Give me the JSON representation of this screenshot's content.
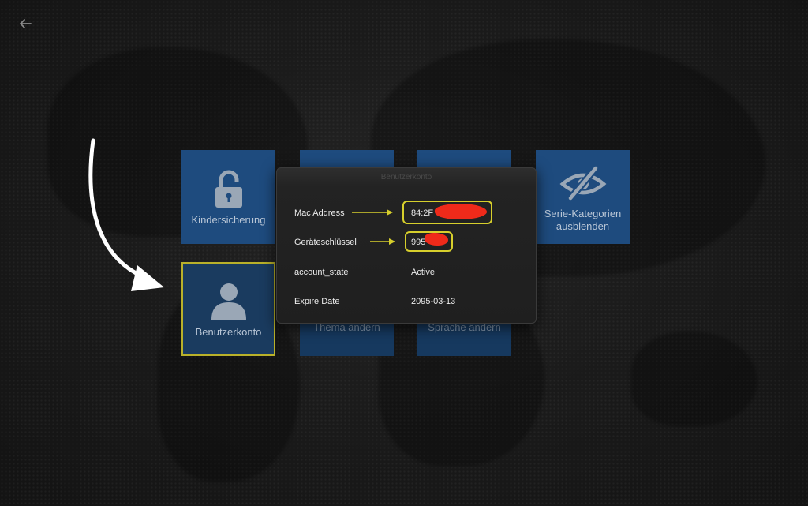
{
  "nav": {
    "back_icon": "arrow-left-icon"
  },
  "tiles": [
    {
      "label": "Kindersicherung",
      "icon": "lock-open-icon"
    },
    {
      "label": "",
      "icon": "pencil-icon"
    },
    {
      "label": "",
      "icon": "pencil-icon"
    },
    {
      "label": "Serie-Kategorien ausblenden",
      "icon": "eye-off-icon"
    },
    {
      "label": "Benutzerkonto",
      "icon": "user-icon"
    },
    {
      "label": "Thema ändern",
      "icon": "palette-icon"
    },
    {
      "label": "Sprache ändern",
      "icon": "language-icon"
    }
  ],
  "dialog": {
    "title": "Benutzerkonto",
    "rows": [
      {
        "label": "Mac Address",
        "value": "84:2F"
      },
      {
        "label": "Geräteschlüssel",
        "value": "995"
      },
      {
        "label": "account_state",
        "value": "Active"
      },
      {
        "label": "Expire Date",
        "value": "2095-03-13"
      }
    ]
  },
  "colors": {
    "tile_blue": "#1e4b7e",
    "highlight_yellow": "#d7cf2c",
    "redaction_red": "#ef2a1a",
    "annotation_arrow": "#ffffff"
  }
}
